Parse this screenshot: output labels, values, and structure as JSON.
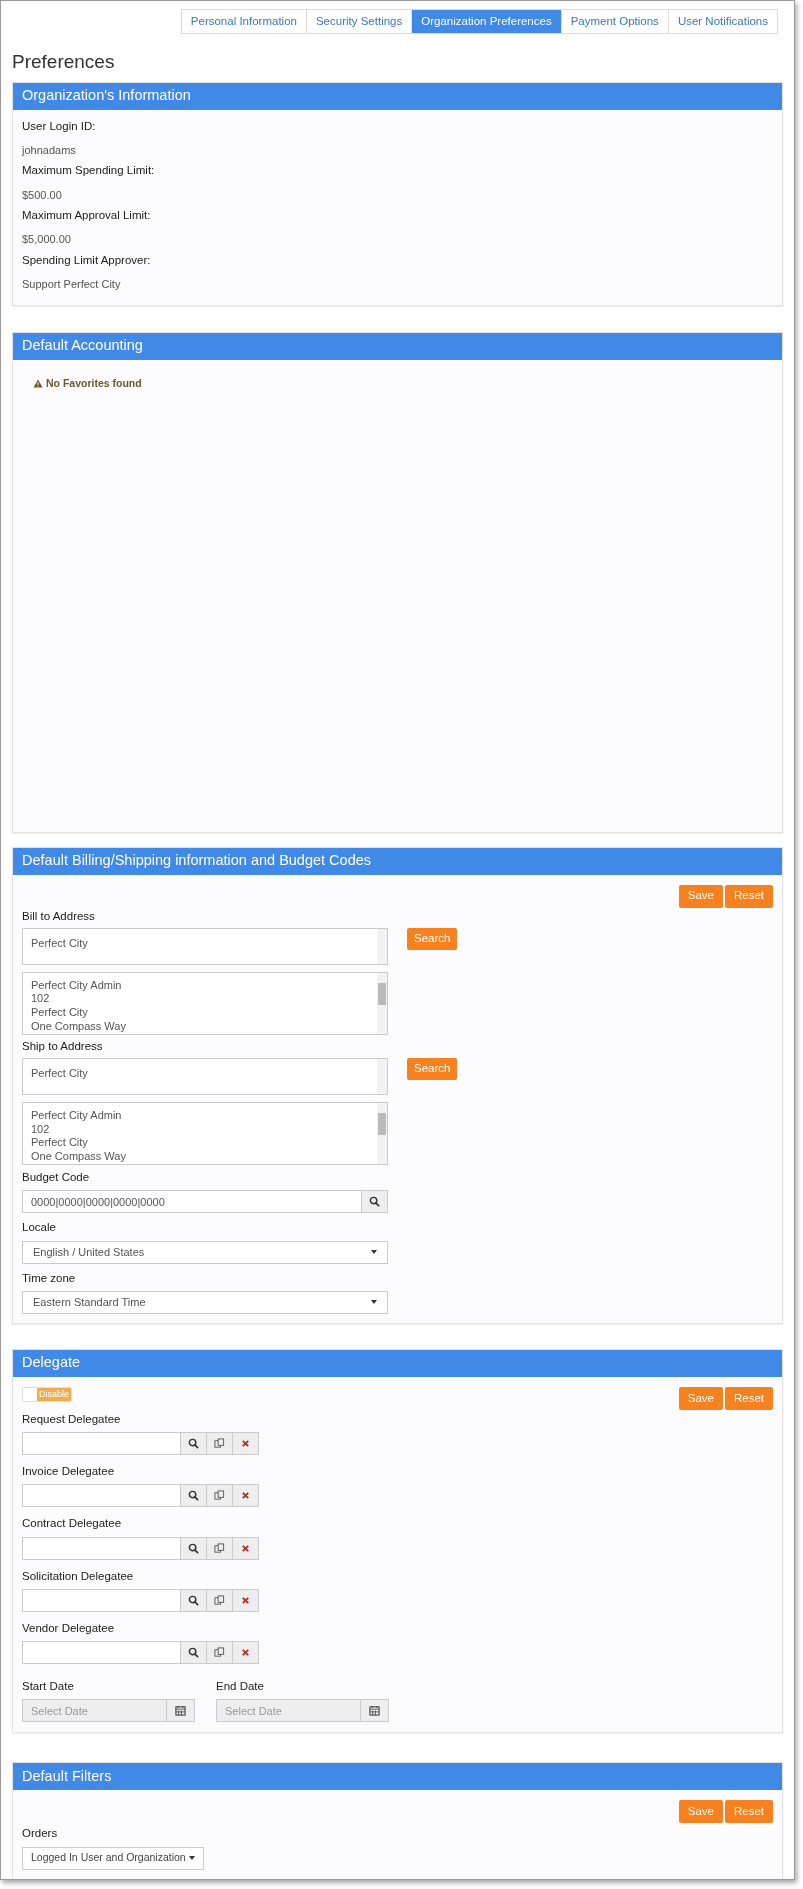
{
  "tabs": [
    {
      "label": "Personal Information",
      "selected": false
    },
    {
      "label": "Security Settings",
      "selected": false
    },
    {
      "label": "Organization Preferences",
      "selected": true
    },
    {
      "label": "Payment Options",
      "selected": false
    },
    {
      "label": "User Notifications",
      "selected": false
    }
  ],
  "page_title": "Preferences",
  "org_info": {
    "title": "Organization's Information",
    "fields": [
      {
        "label": "User Login ID:",
        "value": "johnadams"
      },
      {
        "label": "Maximum Spending Limit:",
        "value": "$500.00"
      },
      {
        "label": "Maximum Approval Limit:",
        "value": "$5,000.00"
      },
      {
        "label": "Spending Limit Approver:",
        "value": "Support Perfect City"
      }
    ]
  },
  "default_accounting": {
    "title": "Default Accounting",
    "notice": "No Favorites found"
  },
  "billing": {
    "title": "Default Billing/Shipping information and Budget Codes",
    "buttons": [
      "Save",
      "Reset"
    ],
    "addresses": [
      {
        "label": "Bill to Address",
        "value": "Perfect City",
        "button": "Search",
        "address_lines": [
          "Perfect City Admin",
          "102",
          "Perfect City",
          "One Compass Way"
        ]
      },
      {
        "label": "Ship to Address",
        "value": "Perfect City",
        "button": "Search",
        "address_lines": [
          "Perfect City Admin",
          "102",
          "Perfect City",
          "One Compass Way"
        ]
      }
    ],
    "budget_code": {
      "label": "Budget Code",
      "value": "0000|0000|0000|0000|0000"
    },
    "selects": [
      {
        "label": "Locale",
        "value": "English / United States"
      },
      {
        "label": "Time zone",
        "value": "Eastern Standard Time"
      }
    ]
  },
  "delegate": {
    "title": "Delegate",
    "toggle": {
      "label": "Disable",
      "on": false
    },
    "buttons": [
      "Save",
      "Reset"
    ],
    "delegatees": [
      "Request Delegatee",
      "Invoice Delegatee",
      "Contract Delegatee",
      "Solicitation Delegatee",
      "Vendor Delegatee"
    ],
    "dates": [
      {
        "label": "Start Date",
        "placeholder": "Select Date"
      },
      {
        "label": "End Date",
        "placeholder": "Select Date"
      }
    ]
  },
  "default_filters": {
    "title": "Default Filters",
    "buttons": [
      "Save",
      "Reset"
    ],
    "orders": {
      "label": "Orders",
      "value": "Logged In User and Organization"
    }
  }
}
